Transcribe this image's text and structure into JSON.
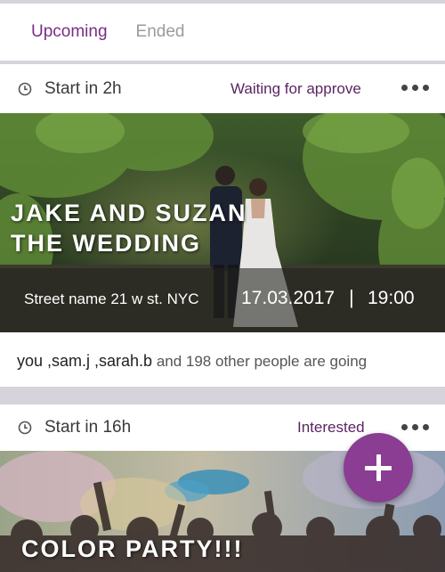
{
  "tabs": {
    "upcoming": "Upcoming",
    "ended": "Ended"
  },
  "events": [
    {
      "start": "Start in 2h",
      "status": "Waiting for approve",
      "title_line1": "JAKE AND SUZAN",
      "title_line2": "THE WEDDING",
      "address": "Street name 21 w st. NYC",
      "date": "17.03.2017",
      "separator": "|",
      "time": "19:00",
      "attendees": "you ,sam.j ,sarah.b",
      "others": "and 198 other people are going"
    },
    {
      "start": "Start in 16h",
      "status": "Interested",
      "title": "COLOR PARTY!!!"
    }
  ],
  "colors": {
    "accent": "#7b2d84",
    "fab": "#8a3d93",
    "status": "#5b2463"
  },
  "icons": {
    "clock": "clock-icon",
    "more": "more-icon",
    "add": "plus-icon"
  }
}
